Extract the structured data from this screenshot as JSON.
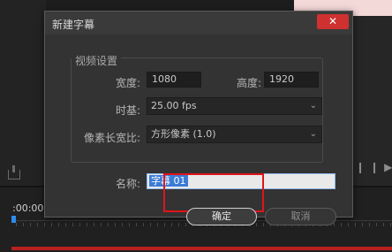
{
  "background": {
    "timecode": ":00:00",
    "accent_color": "#2d8ceb",
    "track_color": "#b8211f"
  },
  "dialog": {
    "title": "新建字幕",
    "close_icon": "close-icon",
    "video_settings": {
      "group_label": "视频设置",
      "width_label": "宽度:",
      "width_value": "1080",
      "height_label": "高度:",
      "height_value": "1920",
      "timebase_label": "时基:",
      "timebase_value": "25.00 fps",
      "pixel_aspect_label": "像素长宽比:",
      "pixel_aspect_value": "方形像素 (1.0)"
    },
    "name_label": "名称:",
    "name_value": "字幕 01",
    "ok_label": "确定",
    "cancel_label": "取消",
    "highlight_color": "#e0141a"
  }
}
